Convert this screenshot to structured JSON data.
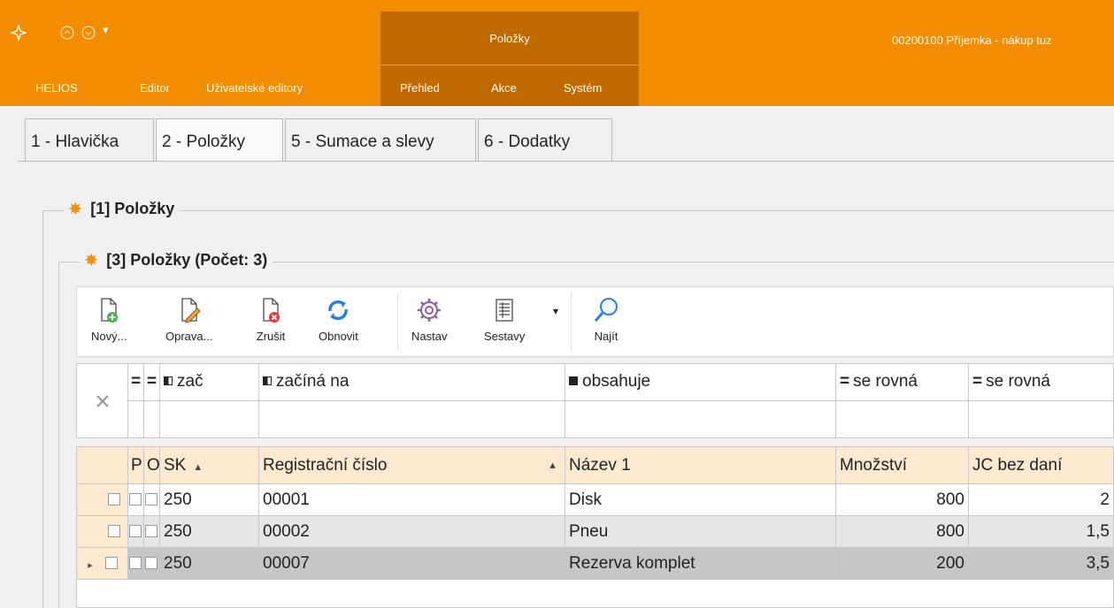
{
  "ribbon": {
    "context_title": "Položky",
    "document_title": "00200100  Příjemka - nákup tuz",
    "tabs": [
      "HELIOS",
      "Editor",
      "Uživatelské editory",
      "Přehled",
      "Akce",
      "Systém"
    ],
    "qat_icons": [
      "app-logo-icon",
      "back-icon",
      "forward-icon",
      "dropdown-icon"
    ]
  },
  "doc_tabs": [
    "1 - Hlavička",
    "2 - Položky",
    "5 - Sumace a slevy",
    "6 - Dodatky"
  ],
  "groups": {
    "outer_title": "[1] Položky",
    "inner_title": "[3] Položky (Počet: 3)"
  },
  "toolbar": {
    "new": "Nový...",
    "edit": "Oprava...",
    "cancel": "Zrušit",
    "refresh": "Obnovit",
    "settings": "Nastav",
    "reports": "Sestavy",
    "find": "Najít"
  },
  "filter": {
    "clear_icon": "close-icon",
    "conditions": [
      "=",
      "=",
      "zač",
      "začíná na",
      "obsahuje",
      "se rovná",
      "se rovná"
    ]
  },
  "grid": {
    "columns": [
      "P",
      "O",
      "SK",
      "Registrační číslo",
      "Název 1",
      "Množství",
      "JC bez daní"
    ],
    "rows": [
      {
        "sk": "250",
        "reg": "00001",
        "name": "Disk",
        "qty": "800",
        "price": "2"
      },
      {
        "sk": "250",
        "reg": "00002",
        "name": "Pneu",
        "qty": "800",
        "price": "1,5"
      },
      {
        "sk": "250",
        "reg": "00007",
        "name": "Rezerva komplet",
        "qty": "200",
        "price": "3,5"
      }
    ],
    "current_row_marker": "▸"
  },
  "colors": {
    "ribbon": "#f28c00",
    "context_tab": "#bf6a00",
    "header_bg": "#fde9d0",
    "row_alt": "#e6e6e6",
    "row_current": "#c6c6c6"
  }
}
